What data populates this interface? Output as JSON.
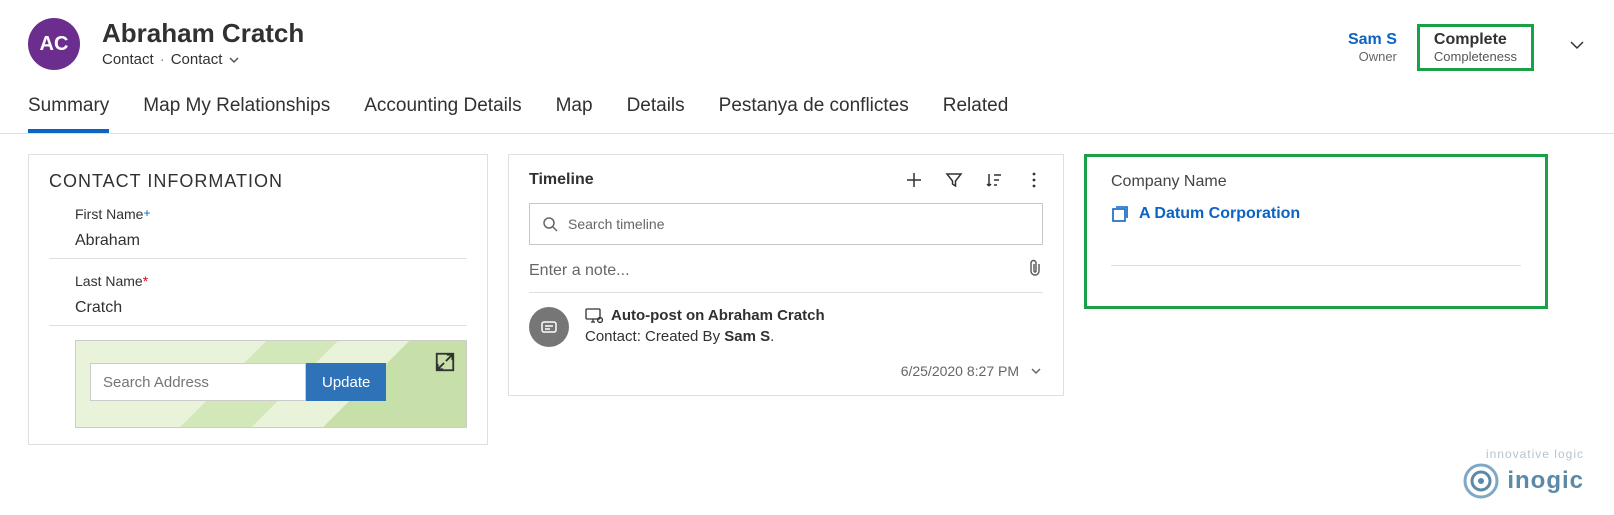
{
  "header": {
    "avatar_initials": "AC",
    "title": "Abraham Cratch",
    "subtitle_entity": "Contact",
    "subtitle_form": "Contact",
    "owner_name": "Sam S",
    "owner_label": "Owner",
    "completeness_value": "Complete",
    "completeness_label": "Completeness"
  },
  "tabs": [
    {
      "label": "Summary",
      "active": true
    },
    {
      "label": "Map My Relationships"
    },
    {
      "label": "Accounting Details"
    },
    {
      "label": "Map"
    },
    {
      "label": "Details"
    },
    {
      "label": "Pestanya de conflictes"
    },
    {
      "label": "Related"
    }
  ],
  "contact_info": {
    "section_title": "CONTACT INFORMATION",
    "first_name_label": "First Name",
    "first_name_value": "Abraham",
    "last_name_label": "Last Name",
    "last_name_value": "Cratch",
    "search_placeholder": "Search Address",
    "update_label": "Update"
  },
  "timeline": {
    "title": "Timeline",
    "search_placeholder": "Search timeline",
    "note_placeholder": "Enter a note...",
    "activity": {
      "title": "Auto-post on Abraham Cratch",
      "prefix": "Contact: Created By ",
      "author": "Sam S",
      "suffix": ".",
      "date": "6/25/2020 8:27 PM"
    }
  },
  "company": {
    "label": "Company Name",
    "value": "A Datum Corporation"
  },
  "branding": {
    "tagline": "innovative logic",
    "name": "inogic"
  }
}
